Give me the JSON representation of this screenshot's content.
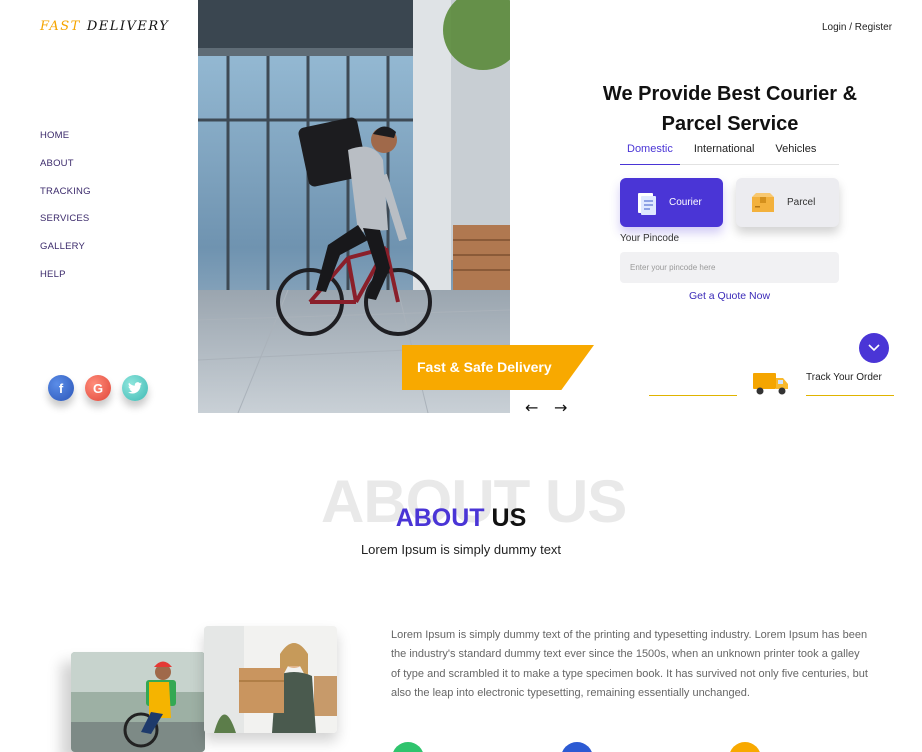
{
  "brand": {
    "word1": "FAST",
    "word2": "DELIVERY"
  },
  "nav": [
    {
      "label": "HOME"
    },
    {
      "label": "ABOUT"
    },
    {
      "label": "TRACKING"
    },
    {
      "label": "SERVICES"
    },
    {
      "label": "GALLERY"
    },
    {
      "label": "HELP"
    }
  ],
  "social": {
    "facebook": "f",
    "google": "G",
    "twitter": "twitter-icon"
  },
  "hero": {
    "banner": "Fast & Safe Delivery",
    "prev_icon": "arrow-left-icon",
    "next_icon": "arrow-right-icon"
  },
  "header": {
    "login": "Login / Register"
  },
  "quote_form": {
    "title": "We Provide Best Courier & Parcel Service",
    "tabs": [
      "Domestic",
      "International",
      "Vehicles"
    ],
    "options": [
      "Courier",
      "Parcel"
    ],
    "pincode_label": "Your Pincode",
    "pincode_placeholder": "Enter your pincode here",
    "pincode_value": "",
    "cta": "Get a Quote Now"
  },
  "track": {
    "label": "Track Your Order"
  },
  "about": {
    "ghost": "ABOUT US",
    "title_accent": "ABOUT",
    "title_rest": "US",
    "subtitle": "Lorem Ipsum is simply dummy text",
    "body": "Lorem Ipsum is simply dummy text of the printing and typesetting industry. Lorem Ipsum has been the industry's standard dummy text ever since the 1500s, when an unknown printer took a galley of type and scrambled it to make a type specimen book. It has survived not only five centuries, but also the leap into electronic typesetting, remaining essentially unchanged."
  },
  "colors": {
    "accent": "#4a35d6",
    "brand_yellow": "#f8a900"
  }
}
